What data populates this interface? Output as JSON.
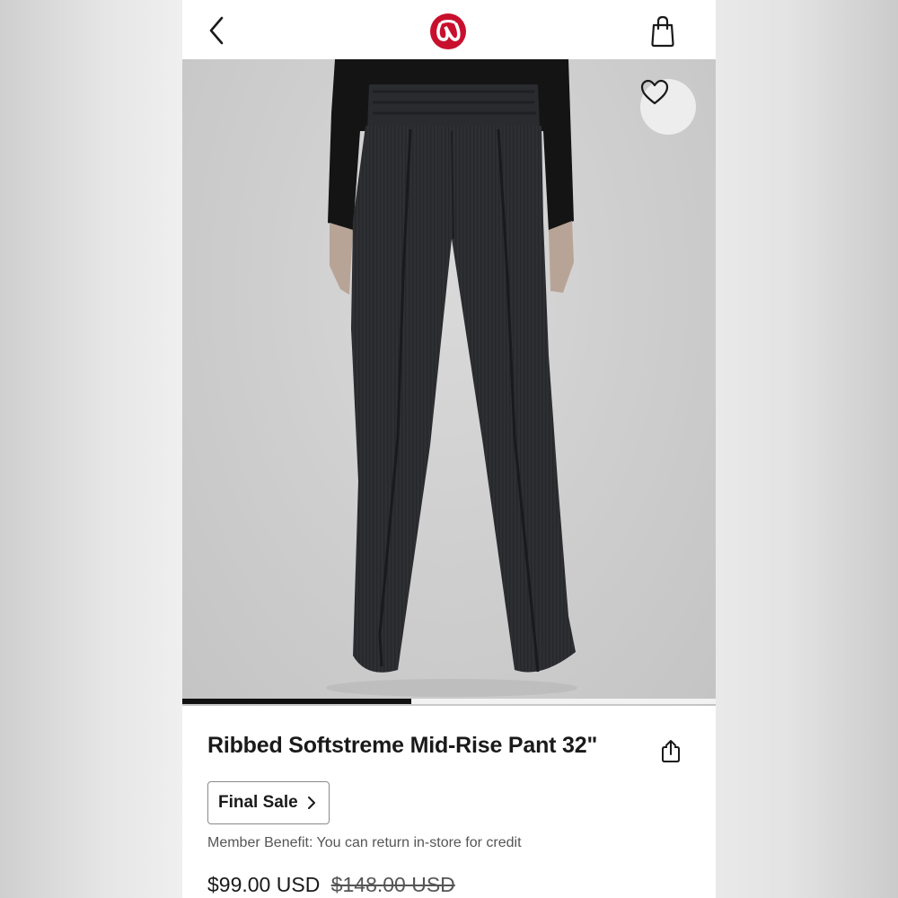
{
  "header": {
    "back_icon": "chevron-left-icon",
    "logo_icon": "lululemon-logo",
    "bag_icon": "shopping-bag-icon",
    "brand_color": "#c8102e"
  },
  "gallery": {
    "favorite_icon": "heart-outline-icon",
    "progress_fraction": 0.43,
    "image_description_icon": "product-photo"
  },
  "product": {
    "title": "Ribbed Softstreme Mid-Rise Pant 32\"",
    "share_icon": "share-icon",
    "final_sale_label": "Final Sale",
    "final_sale_chevron": "›",
    "member_benefit": "Member Benefit: You can return in-store for credit",
    "price_current": "$99.00 USD",
    "price_original": "$148.00 USD"
  }
}
